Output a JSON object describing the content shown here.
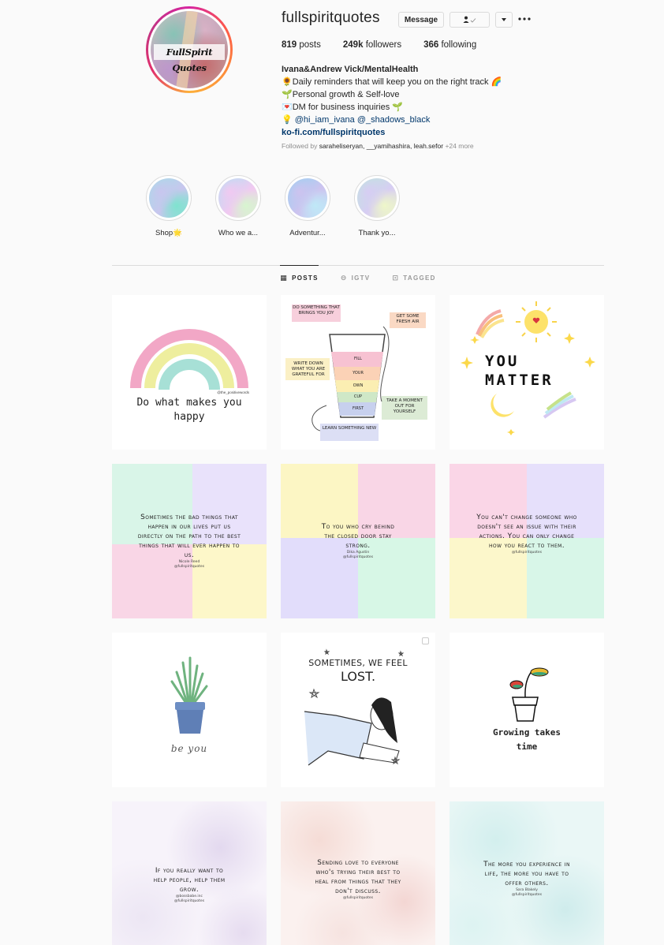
{
  "profile": {
    "username": "fullspiritquotes",
    "avatar_label": "FullSpirit Quotes",
    "buttons": {
      "message": "Message",
      "follow_icon": "person-check-icon",
      "dropdown_icon": "caret-down-icon",
      "more_icon": "ellipsis-icon"
    },
    "stats": [
      {
        "value": "819",
        "label": "posts"
      },
      {
        "value": "249k",
        "label": "followers"
      },
      {
        "value": "366",
        "label": "following"
      }
    ],
    "bio": {
      "name": "Ivana&Andrew Vick/MentalHealth",
      "lines": [
        {
          "emoji": "🌻",
          "text": "Daily reminders that will keep you on the right track",
          "trail": "🌈"
        },
        {
          "emoji": "🌱",
          "text": "Personal growth & Self-love",
          "trail": ""
        },
        {
          "emoji": "💌",
          "text": "DM for business inquiries",
          "trail": "🌱"
        }
      ],
      "mentions_emoji": "💡",
      "mentions": [
        "@hi_iam_ivana",
        "@_shadows_black"
      ],
      "website": "ko-fi.com/fullspiritquotes"
    },
    "followed_by": {
      "prefix": "Followed by",
      "users": "saraheliseryan, __yamihashira, leah.sefor",
      "more": "+24 more"
    }
  },
  "highlights": [
    {
      "label": "Shop🌟",
      "colors": [
        "#9fe3e6",
        "#c8c6ee",
        "#7fe3cf"
      ]
    },
    {
      "label": "Who we a...",
      "colors": [
        "#a7e6f2",
        "#f1c9f1",
        "#d7f5cf"
      ]
    },
    {
      "label": "Adventur...",
      "colors": [
        "#8fd6f2",
        "#cdc3ef",
        "#bfe9f7"
      ]
    },
    {
      "label": "Thank yo...",
      "colors": [
        "#b9ecd9",
        "#d7cdf3",
        "#eef7c9"
      ]
    }
  ],
  "tabs": [
    {
      "label": "POSTS",
      "icon": "▦",
      "active": true
    },
    {
      "label": "IGTV",
      "icon": "⊖",
      "active": false
    },
    {
      "label": "TAGGED",
      "icon": "⊡",
      "active": false
    }
  ],
  "posts": [
    {
      "kind": "rainbow",
      "text": "Do what makes you happy",
      "credit": "@the_positivewords"
    },
    {
      "kind": "cup",
      "title": "FILL YOUR OWN CUP FIRST",
      "notes": [
        "DO SOMETHING THAT BRINGS YOU JOY",
        "GET SOME FRESH AIR",
        "WRITE DOWN WHAT YOU ARE GRATEFUL FOR",
        "TAKE A MOMENT OUT FOR YOURSELF",
        "LEARN SOMETHING NEW"
      ],
      "layers": [
        "FILL",
        "YOUR",
        "OWN",
        "CUP",
        "FIRST"
      ]
    },
    {
      "kind": "matter",
      "text": "YOU MATTER"
    },
    {
      "kind": "quote",
      "style": "pastel4",
      "text": "Sometimes the bad things that happen in our lives put us directly on the path to the best things that will ever happen to us.",
      "author": "Nicole Reed",
      "handle": "@fullspiritquotes"
    },
    {
      "kind": "quote",
      "style": "pastel4-b",
      "text": "To you who cry behind the closed door stay strong.",
      "author": "Dika Agustin",
      "handle": "@fullspiritquotes"
    },
    {
      "kind": "quote",
      "style": "pastel4-c",
      "text": "You can't change someone who doesn't see an issue with their actions. You can only change how you react to them.",
      "author": "",
      "handle": "@fullspiritquotes"
    },
    {
      "kind": "plant",
      "text": "be you"
    },
    {
      "kind": "lost",
      "text_small": "SOMETIMES, WE FEEL",
      "text_big": "LOST."
    },
    {
      "kind": "growing",
      "text": "Growing takes time"
    },
    {
      "kind": "quote",
      "style": "ink-purple",
      "text": "If you really want to help people, help them grow.",
      "author": "@bossbabe.inc",
      "handle": "@fullspiritquotes"
    },
    {
      "kind": "quote",
      "style": "ink-pink",
      "text": "Sending love to everyone who's trying their best to heal from things that they don't discuss.",
      "author": "",
      "handle": "@fullspiritquotes"
    },
    {
      "kind": "quote",
      "style": "ink-teal",
      "text": "The more you experience in life, the more you have to offer others.",
      "author": "Sara Blakely",
      "handle": "@fullspiritquotes"
    }
  ]
}
